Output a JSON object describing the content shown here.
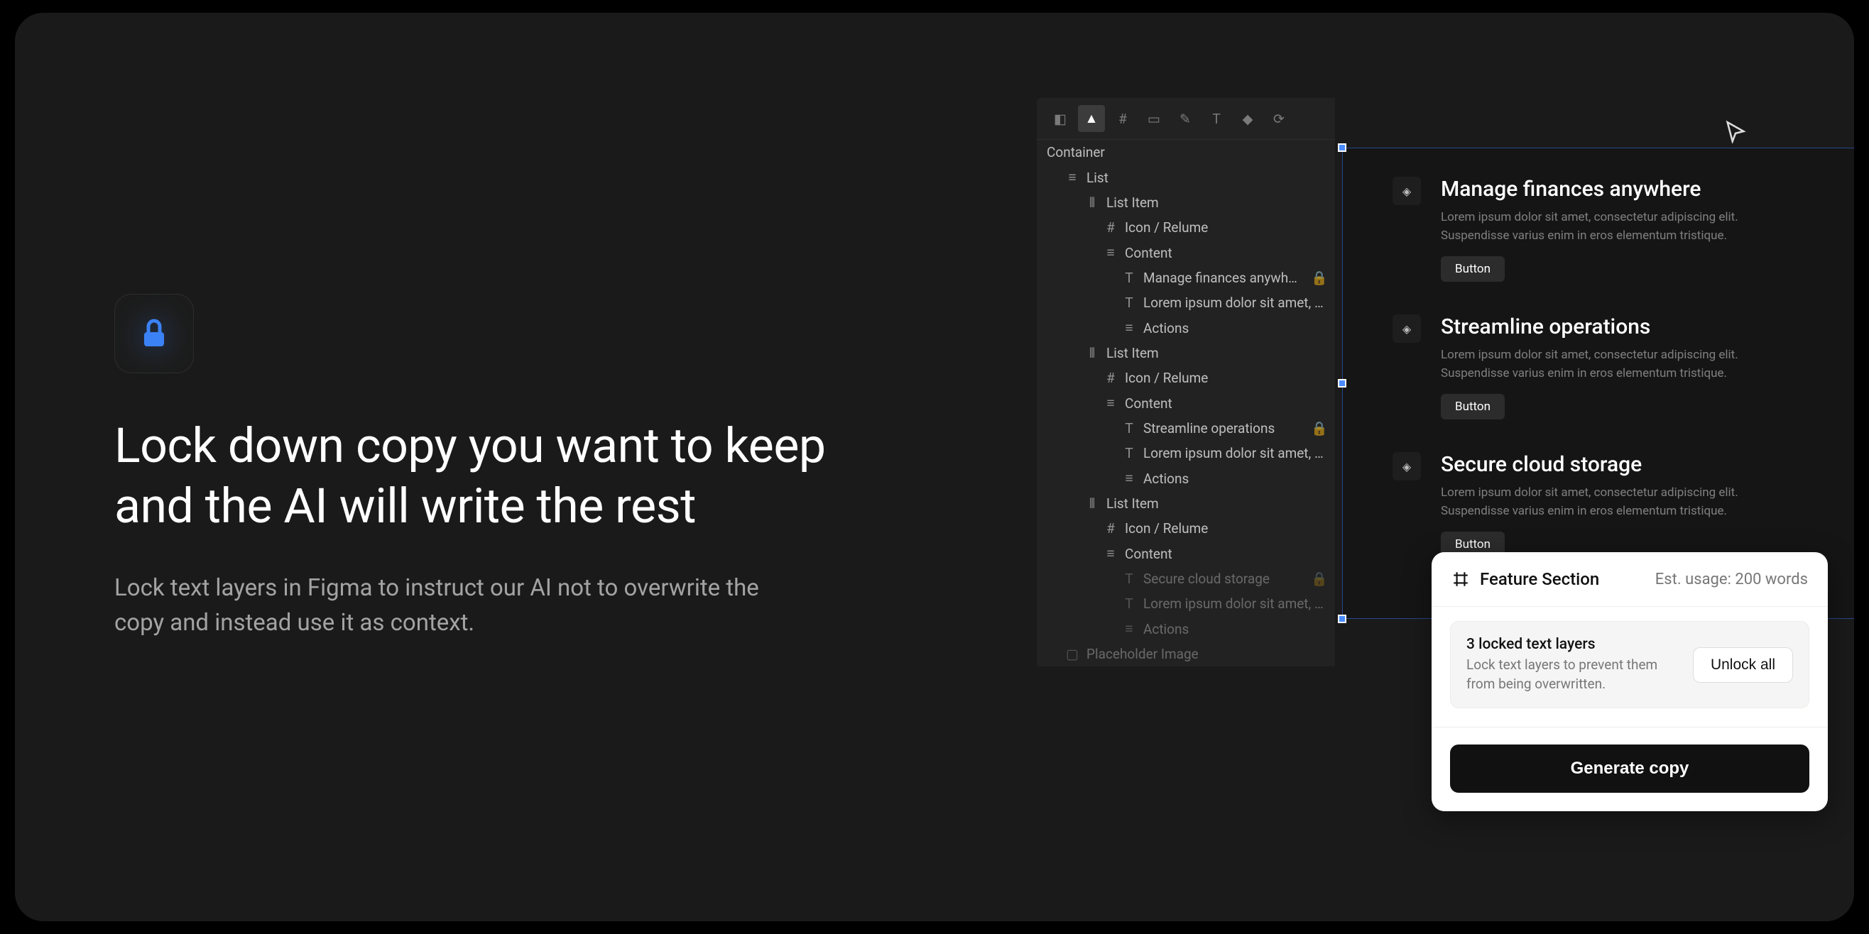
{
  "hero": {
    "headline": "Lock down copy you want to keep and the AI will write the rest",
    "subtitle": "Lock text layers in Figma to instruct our AI not to overwrite the copy and instead use it as context."
  },
  "layers": {
    "container": "Container",
    "list": "List",
    "list_item": "List Item",
    "icon_relume": "Icon / Relume",
    "content": "Content",
    "actions": "Actions",
    "placeholder_image": "Placeholder Image",
    "items": [
      {
        "title": "Manage finances anywhere",
        "lorem": "Lorem ipsum dolor sit amet, conse...",
        "locked": true
      },
      {
        "title": "Streamline operations",
        "lorem": "Lorem ipsum dolor sit amet, conse...",
        "locked": true
      },
      {
        "title": "Secure cloud storage",
        "lorem": "Lorem ipsum dolor sit amet, conse...",
        "locked": true
      }
    ]
  },
  "preview": {
    "desc": "Lorem ipsum dolor sit amet, consectetur adipiscing elit. Suspendisse varius enim in eros elementum tristique.",
    "button": "Button",
    "features": [
      "Manage finances anywhere",
      "Streamline operations",
      "Secure cloud storage"
    ]
  },
  "popup": {
    "title": "Feature Section",
    "usage": "Est. usage: 200 words",
    "locked_title": "3 locked text layers",
    "locked_desc": "Lock text layers to prevent them from being overwritten.",
    "unlock": "Unlock all",
    "generate": "Generate copy"
  }
}
